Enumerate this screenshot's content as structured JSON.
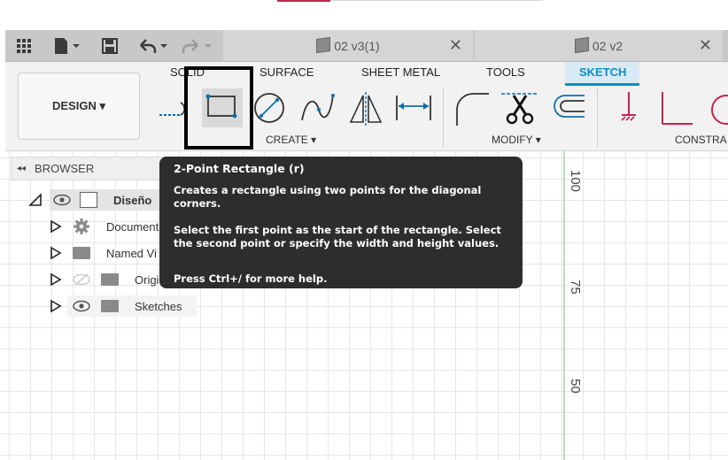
{
  "tabs": {
    "doc1": {
      "label": "02 v3(1)",
      "close": "✕"
    },
    "doc2": {
      "label": "02 v2",
      "close": "✕"
    }
  },
  "toolbar": {
    "workspace_button": "DESIGN ▾",
    "workspace_tabs": [
      {
        "label": "SOLID"
      },
      {
        "label": "SURFACE"
      },
      {
        "label": "SHEET METAL"
      },
      {
        "label": "TOOLS"
      },
      {
        "label": "SKETCH",
        "active": true
      }
    ],
    "groups": {
      "create": "CREATE ▾",
      "modify": "MODIFY ▾",
      "constrain": "CONSTRA"
    },
    "accent_color": "#0a8fc7"
  },
  "browser": {
    "header": "BROWSER",
    "collapse_glyph": "◂◂",
    "items": [
      {
        "label": "Diseño",
        "icon": "component-icon"
      },
      {
        "label": "Document",
        "icon": "gear-icon"
      },
      {
        "label": "Named Vi",
        "icon": "folder-icon"
      },
      {
        "label": "Origi",
        "icon": "folder-icon"
      },
      {
        "label": "Sketches",
        "icon": "folder-icon"
      }
    ]
  },
  "tooltip": {
    "title": "2-Point Rectangle (r)",
    "line1": "Creates a rectangle using two points for the diagonal corners.",
    "line2": "Select the first point as the start of the rectangle. Select the second point or specify the width and height values.",
    "line3": "Press Ctrl+/ for more help."
  },
  "canvas": {
    "axis_labels": [
      "100",
      "75",
      "50"
    ]
  }
}
